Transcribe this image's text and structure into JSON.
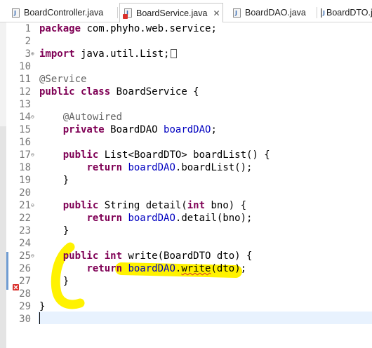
{
  "tabs": [
    {
      "label": "BoardController.java",
      "active": false,
      "error": false
    },
    {
      "label": "BoardService.java",
      "active": true,
      "error": true,
      "close": "✕"
    },
    {
      "label": "BoardDAO.java",
      "active": false,
      "error": false
    },
    {
      "label": "BoardDTO.j",
      "active": false,
      "error": false
    }
  ],
  "colors": {
    "keyword": "#7f0055",
    "annotation": "#646464",
    "field": "#0000c0",
    "highlight": "#fff200",
    "error": "#d9302c"
  },
  "editor": {
    "lines": [
      {
        "num": "1",
        "text": "package com.phyho.web.service;"
      },
      {
        "num": "2",
        "text": ""
      },
      {
        "num": "3",
        "text": "import java.util.List;",
        "fold": "⊕"
      },
      {
        "num": "10",
        "text": ""
      },
      {
        "num": "11",
        "text": "@Service"
      },
      {
        "num": "12",
        "text": "public class BoardService {"
      },
      {
        "num": "13",
        "text": ""
      },
      {
        "num": "14",
        "text": "@Autowired",
        "fold": "⊖"
      },
      {
        "num": "15",
        "text": "private BoardDAO boardDAO;"
      },
      {
        "num": "16",
        "text": ""
      },
      {
        "num": "17",
        "text": "public List<BoardDTO> boardList() {",
        "fold": "⊖"
      },
      {
        "num": "18",
        "text": "return boardDAO.boardList();"
      },
      {
        "num": "19",
        "text": "}"
      },
      {
        "num": "20",
        "text": ""
      },
      {
        "num": "21",
        "text": "public String detail(int bno) {",
        "fold": "⊖"
      },
      {
        "num": "22",
        "text": "return boardDAO.detail(bno);"
      },
      {
        "num": "23",
        "text": "}"
      },
      {
        "num": "24",
        "text": ""
      },
      {
        "num": "25",
        "text": "public int write(BoardDTO dto) {",
        "fold": "⊖"
      },
      {
        "num": "26",
        "text": "return boardDAO.write(dto);"
      },
      {
        "num": "27",
        "text": "}"
      },
      {
        "num": "28",
        "text": ""
      },
      {
        "num": "29",
        "text": "}"
      },
      {
        "num": "30",
        "text": ""
      }
    ]
  }
}
